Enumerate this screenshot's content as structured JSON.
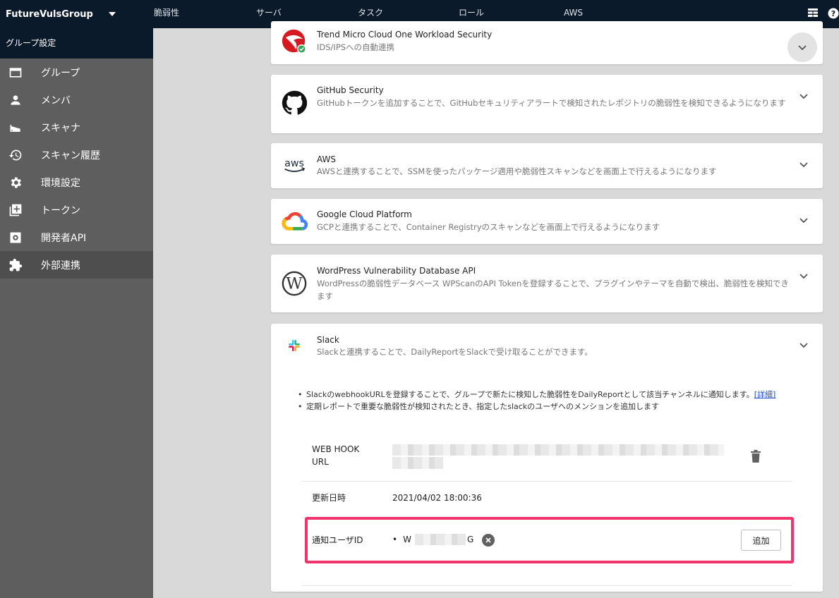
{
  "header": {
    "group_name": "FutureVulsGroup",
    "nav": [
      "脆弱性",
      "サーバ",
      "タスク",
      "ロール",
      "AWS"
    ]
  },
  "sidebar": {
    "title": "グループ設定",
    "items": [
      {
        "label": "グループ",
        "icon": "group-card-icon"
      },
      {
        "label": "メンバ",
        "icon": "person-icon"
      },
      {
        "label": "スキャナ",
        "icon": "scanner-icon"
      },
      {
        "label": "スキャン履歴",
        "icon": "history-icon"
      },
      {
        "label": "環境設定",
        "icon": "gear-icon"
      },
      {
        "label": "トークン",
        "icon": "add-box-icon"
      },
      {
        "label": "開発者API",
        "icon": "api-icon"
      },
      {
        "label": "外部連携",
        "icon": "puzzle-icon",
        "active": true
      }
    ]
  },
  "integrations": [
    {
      "title": "Trend Micro Cloud One Workload Security",
      "desc": "IDS/IPSへの自動連携"
    },
    {
      "title": "GitHub Security",
      "desc": "GitHubトークンを追加することで、GitHubセキュリティアラートで検知されたレポジトリの脆弱性を検知できるようになります"
    },
    {
      "title": "AWS",
      "desc": "AWSと連携することで、SSMを使ったパッケージ適用や脆弱性スキャンなどを画面上で行えるようになります"
    },
    {
      "title": "Google Cloud Platform",
      "desc": "GCPと連携することで、Container Registryのスキャンなどを画面上で行えるようになります"
    },
    {
      "title": "WordPress Vulnerability Database API",
      "desc": "WordPressの脆弱性データベース WPScanのAPI Tokenを登録することで、プラグインやテーマを自動で検出、脆弱性を検知できます"
    },
    {
      "title": "Slack",
      "desc": "Slackと連携することで、DailyReportをSlackで受け取ることができます。"
    }
  ],
  "slack": {
    "note1": "SlackのwebhookURLを登録することで、グループで新たに検知した脆弱性をDailyReportとして該当チャンネルに通知します。",
    "note1_link": "[詳細]",
    "note2": "定期レポートで重要な脆弱性が検知されたとき、指定したslackのユーザへのメンションを追加します",
    "webhook_label_1": "WEB HOOK",
    "webhook_label_2": "URL",
    "updated_label": "更新日時",
    "updated_value": "2021/04/02 18:00:36",
    "notify_label": "通知ユーザID",
    "notify_user_prefix": "W",
    "notify_user_suffix": "G",
    "add_button": "追加"
  },
  "colors": {
    "header_bg": "#0b1a2b",
    "sidebar_bg": "#5e5e5e",
    "highlight": "#f0346e"
  }
}
